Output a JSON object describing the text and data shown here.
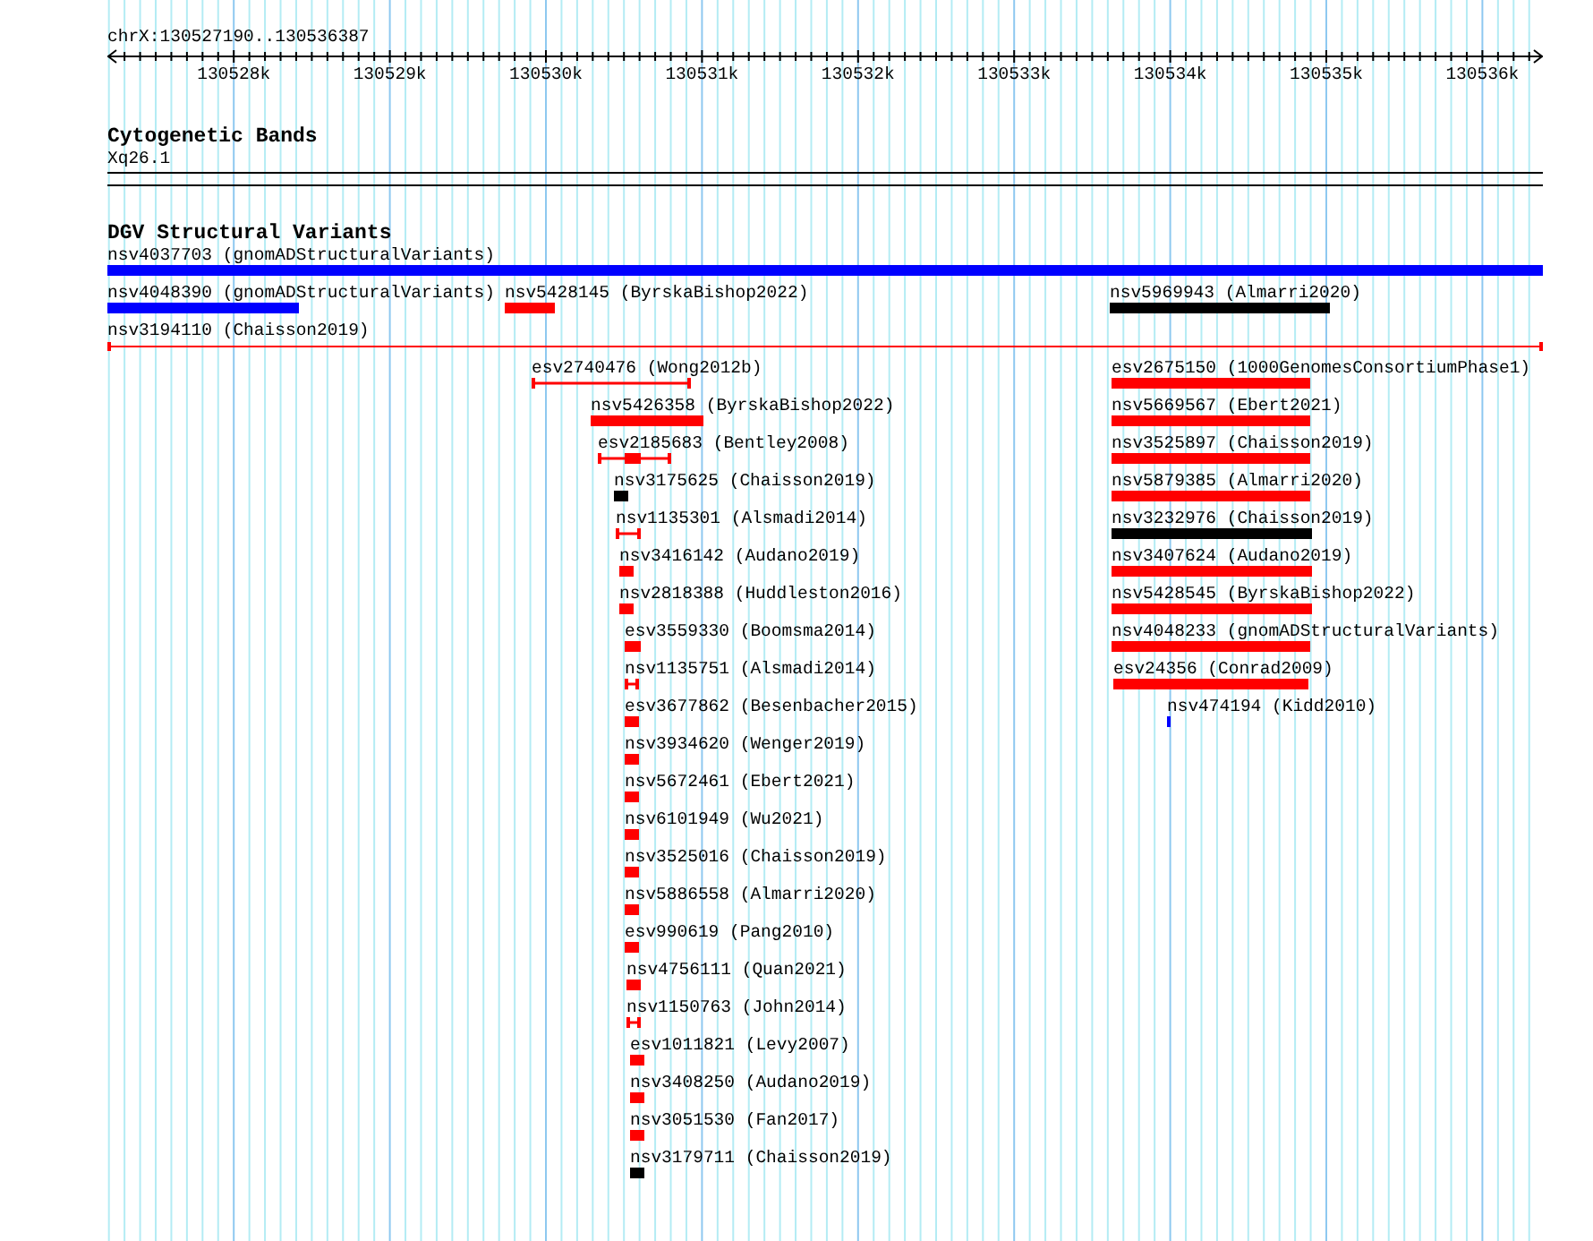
{
  "ruler": {
    "location": "chrX:130527190..130536387",
    "ticks": [
      "130528k",
      "130529k",
      "130530k",
      "130531k",
      "130532k",
      "130533k",
      "130534k",
      "130535k",
      "130536k"
    ]
  },
  "cytogenetic_track": {
    "title": "Cytogenetic Bands",
    "band": "Xq26.1"
  },
  "dgv_track": {
    "title": "DGV Structural Variants",
    "features": [
      {
        "label": "nsv4037703 (gnomADStructuralVariants)",
        "color": "#0000ff",
        "kind": "bar"
      },
      {
        "label": "nsv4048390 (gnomADStructuralVariants)",
        "color": "#0000ff",
        "kind": "bar"
      },
      {
        "label": "nsv5428145 (ByrskaBishop2022)",
        "color": "#ff0000",
        "kind": "bar"
      },
      {
        "label": "nsv5969943 (Almarri2020)",
        "color": "#000000",
        "kind": "bar"
      },
      {
        "label": "nsv3194110 (Chaisson2019)",
        "color": "#ff0000",
        "kind": "line"
      },
      {
        "label": "esv2740476 (Wong2012b)",
        "color": "#ff0000",
        "kind": "span"
      },
      {
        "label": "esv2675150 (1000GenomesConsortiumPhase1)",
        "color": "#ff0000",
        "kind": "bar"
      },
      {
        "label": "nsv5426358 (ByrskaBishop2022)",
        "color": "#ff0000",
        "kind": "bar"
      },
      {
        "label": "nsv5669567 (Ebert2021)",
        "color": "#ff0000",
        "kind": "bar"
      },
      {
        "label": "esv2185683 (Bentley2008)",
        "color": "#ff0000",
        "kind": "span-core"
      },
      {
        "label": "nsv3525897 (Chaisson2019)",
        "color": "#ff0000",
        "kind": "bar"
      },
      {
        "label": "nsv3175625 (Chaisson2019)",
        "color": "#000000",
        "kind": "bar"
      },
      {
        "label": "nsv5879385 (Almarri2020)",
        "color": "#ff0000",
        "kind": "bar"
      },
      {
        "label": "nsv1135301 (Alsmadi2014)",
        "color": "#ff0000",
        "kind": "span"
      },
      {
        "label": "nsv3232976 (Chaisson2019)",
        "color": "#000000",
        "kind": "bar"
      },
      {
        "label": "nsv3416142 (Audano2019)",
        "color": "#ff0000",
        "kind": "bar"
      },
      {
        "label": "nsv3407624 (Audano2019)",
        "color": "#ff0000",
        "kind": "bar"
      },
      {
        "label": "nsv2818388 (Huddleston2016)",
        "color": "#ff0000",
        "kind": "bar"
      },
      {
        "label": "nsv5428545 (ByrskaBishop2022)",
        "color": "#ff0000",
        "kind": "bar"
      },
      {
        "label": "esv3559330 (Boomsma2014)",
        "color": "#ff0000",
        "kind": "bar"
      },
      {
        "label": "nsv4048233 (gnomADStructuralVariants)",
        "color": "#ff0000",
        "kind": "bar"
      },
      {
        "label": "nsv1135751 (Alsmadi2014)",
        "color": "#ff0000",
        "kind": "span"
      },
      {
        "label": "esv24356 (Conrad2009)",
        "color": "#ff0000",
        "kind": "bar"
      },
      {
        "label": "esv3677862 (Besenbacher2015)",
        "color": "#ff0000",
        "kind": "bar"
      },
      {
        "label": "nsv474194 (Kidd2010)",
        "color": "#0000ff",
        "kind": "bar"
      },
      {
        "label": "nsv3934620 (Wenger2019)",
        "color": "#ff0000",
        "kind": "bar"
      },
      {
        "label": "nsv5672461 (Ebert2021)",
        "color": "#ff0000",
        "kind": "bar"
      },
      {
        "label": "nsv6101949 (Wu2021)",
        "color": "#ff0000",
        "kind": "bar"
      },
      {
        "label": "nsv3525016 (Chaisson2019)",
        "color": "#ff0000",
        "kind": "bar"
      },
      {
        "label": "nsv5886558 (Almarri2020)",
        "color": "#ff0000",
        "kind": "bar"
      },
      {
        "label": "esv990619 (Pang2010)",
        "color": "#ff0000",
        "kind": "bar"
      },
      {
        "label": "nsv4756111 (Quan2021)",
        "color": "#ff0000",
        "kind": "bar"
      },
      {
        "label": "nsv1150763 (John2014)",
        "color": "#ff0000",
        "kind": "span"
      },
      {
        "label": "esv1011821 (Levy2007)",
        "color": "#ff0000",
        "kind": "bar"
      },
      {
        "label": "nsv3408250 (Audano2019)",
        "color": "#ff0000",
        "kind": "bar"
      },
      {
        "label": "nsv3051530 (Fan2017)",
        "color": "#ff0000",
        "kind": "bar"
      },
      {
        "label": "nsv3179711 (Chaisson2019)",
        "color": "#000000",
        "kind": "bar"
      }
    ]
  }
}
